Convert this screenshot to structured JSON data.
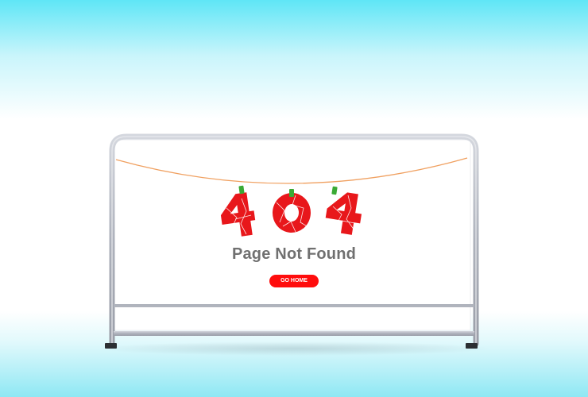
{
  "page": {
    "error_code": "404",
    "title": "Page Not Found",
    "button_label": "GO HOME"
  },
  "colors": {
    "accent": "#ff0d0d",
    "digit_red": "#e8171b",
    "title_gray": "#707070",
    "rope": "#f0a060",
    "pin_green": "#3aaa35",
    "frame_gray": "#b9bdc6"
  }
}
